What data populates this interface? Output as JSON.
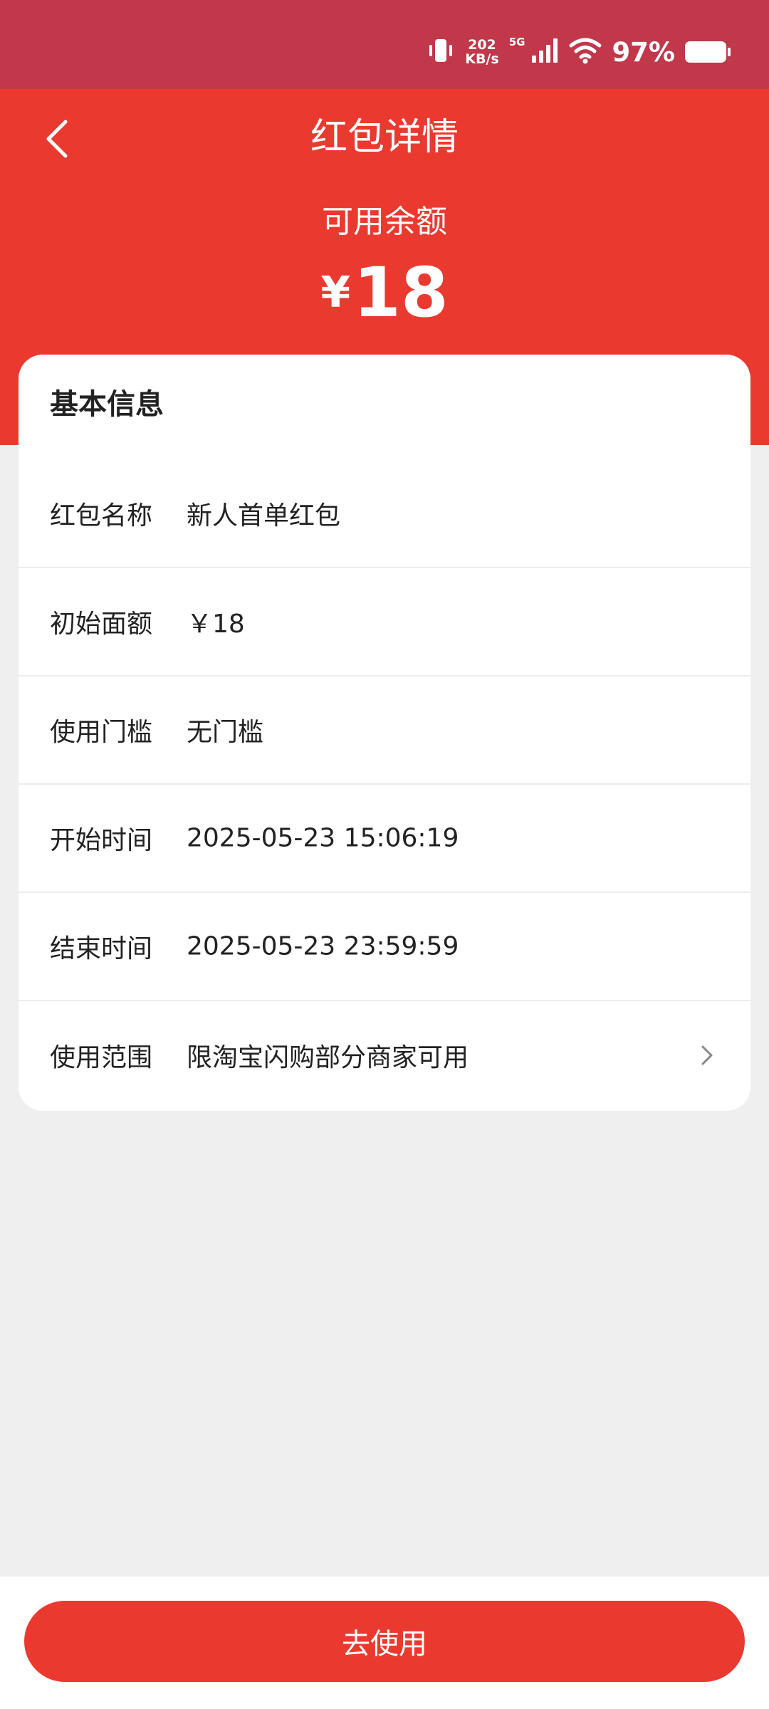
{
  "status_bar": {
    "net_speed_value": "202",
    "net_speed_unit": "KB/s",
    "network_type": "5G",
    "battery_percent": "97%",
    "battery_level": 0.97,
    "icons": [
      "vibrate-icon",
      "signal-icon",
      "wifi-icon",
      "battery-icon"
    ]
  },
  "header": {
    "title": "红包详情",
    "back_icon": "chevron-left-icon",
    "balance_label": "可用余额",
    "balance_currency": "¥",
    "balance_value": "18"
  },
  "card": {
    "title": "基本信息",
    "rows": [
      {
        "label": "红包名称",
        "value": "新人首单红包"
      },
      {
        "label": "初始面额",
        "value": "￥18"
      },
      {
        "label": "使用门槛",
        "value": "无门槛"
      },
      {
        "label": "开始时间",
        "value": "2025-05-23 15:06:19"
      },
      {
        "label": "结束时间",
        "value": "2025-05-23 23:59:59"
      },
      {
        "label": "使用范围",
        "value": "限淘宝闪购部分商家可用",
        "has_chevron": true
      }
    ]
  },
  "footer": {
    "use_button_label": "去使用"
  },
  "colors": {
    "status_bar_bg": "#c0384a",
    "header_red": "#ea3a30",
    "page_bg": "#efefef",
    "card_bg": "#ffffff"
  }
}
